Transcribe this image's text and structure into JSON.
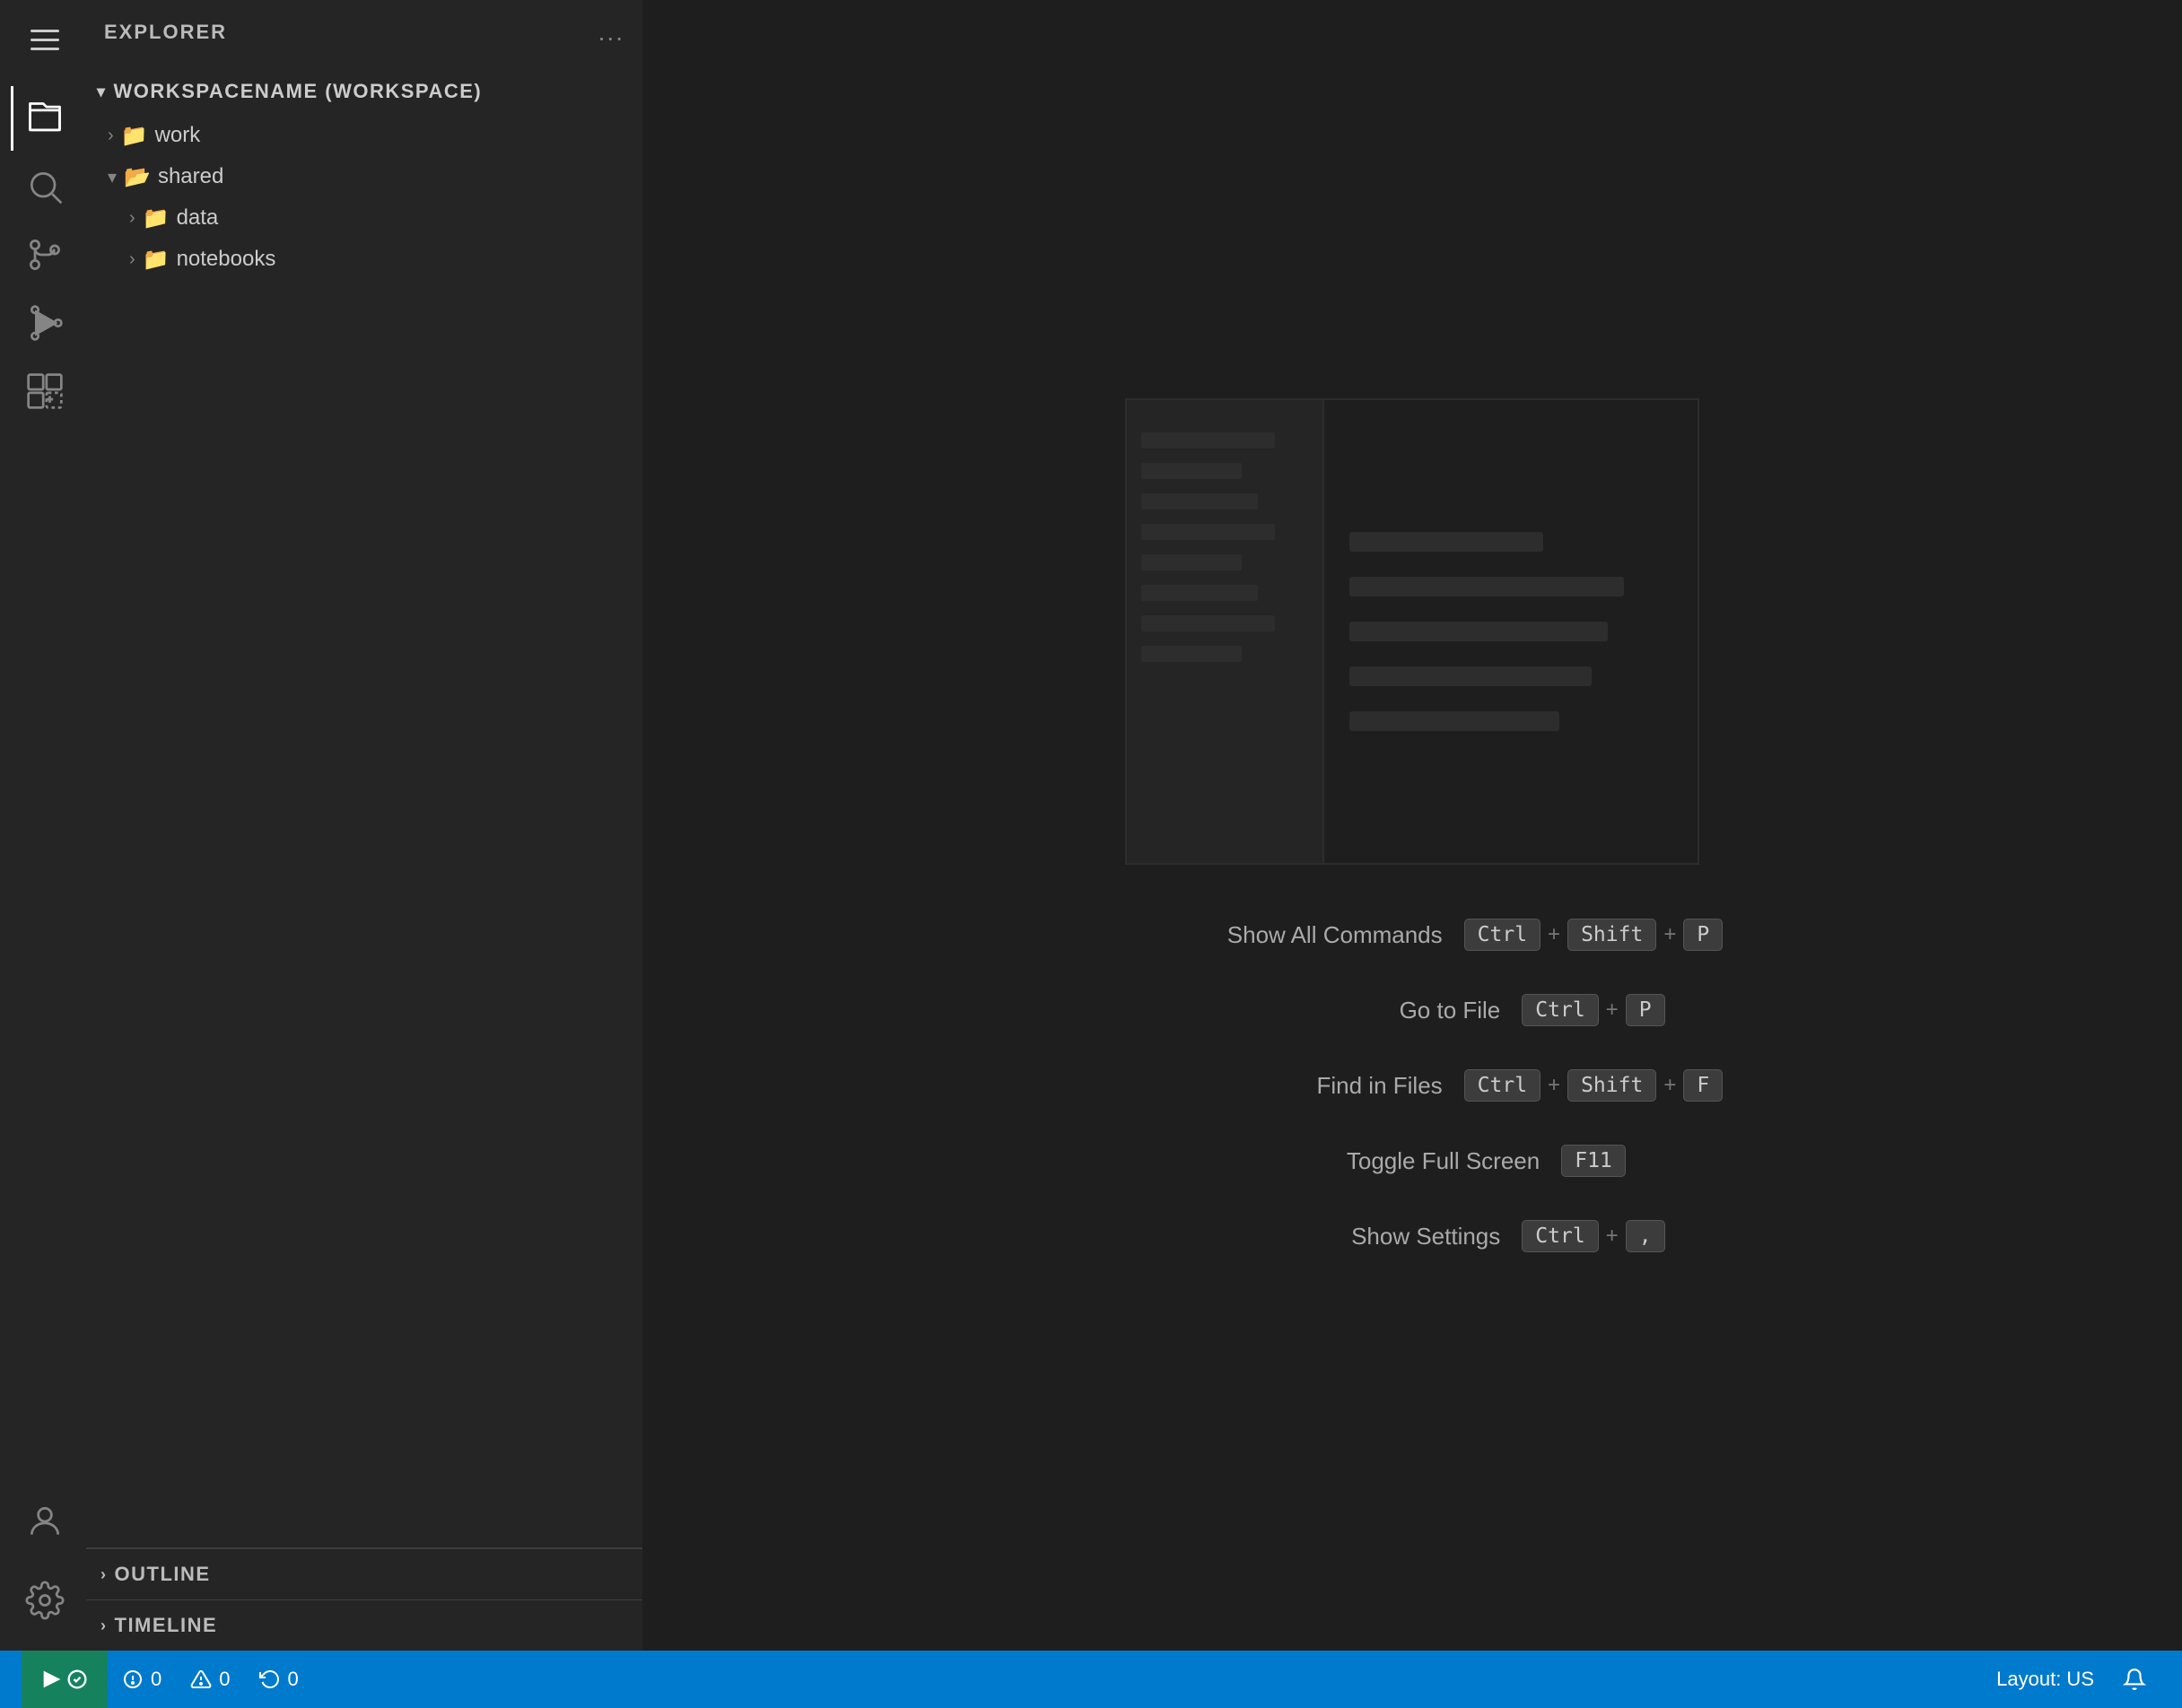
{
  "activityBar": {
    "icons": [
      {
        "name": "files-icon",
        "symbol": "files",
        "active": true
      },
      {
        "name": "search-icon",
        "symbol": "search"
      },
      {
        "name": "source-control-icon",
        "symbol": "source-control"
      },
      {
        "name": "run-debug-icon",
        "symbol": "run"
      },
      {
        "name": "extensions-icon",
        "symbol": "extensions"
      }
    ],
    "bottomIcons": [
      {
        "name": "account-icon",
        "symbol": "account"
      },
      {
        "name": "settings-icon",
        "symbol": "settings"
      }
    ]
  },
  "sidebar": {
    "header": "Explorer",
    "moreButton": "...",
    "tree": {
      "workspaceName": "WORKSPACENAME (WORKSPACE)",
      "items": [
        {
          "label": "work",
          "indent": 1,
          "collapsed": true,
          "type": "folder"
        },
        {
          "label": "shared",
          "indent": 1,
          "collapsed": false,
          "type": "folder"
        },
        {
          "label": "data",
          "indent": 2,
          "collapsed": true,
          "type": "folder"
        },
        {
          "label": "notebooks",
          "indent": 2,
          "collapsed": true,
          "type": "folder"
        }
      ]
    }
  },
  "bottomPanels": [
    {
      "label": "OUTLINE"
    },
    {
      "label": "TIMELINE"
    }
  ],
  "welcomeScreen": {
    "shortcuts": [
      {
        "label": "Show All Commands",
        "keys": [
          "Ctrl",
          "+",
          "Shift",
          "+",
          "P"
        ]
      },
      {
        "label": "Go to File",
        "keys": [
          "Ctrl",
          "+",
          "P"
        ]
      },
      {
        "label": "Find in Files",
        "keys": [
          "Ctrl",
          "+",
          "Shift",
          "+",
          "F"
        ]
      },
      {
        "label": "Toggle Full Screen",
        "keys": [
          "F11"
        ]
      },
      {
        "label": "Show Settings",
        "keys": [
          "Ctrl",
          "+",
          ","
        ]
      }
    ]
  },
  "statusBar": {
    "leftItems": [
      {
        "label": "⚙ 0",
        "icon": "error-icon"
      },
      {
        "label": "⚠ 0"
      },
      {
        "label": "↺ 0",
        "icon": "sync-icon"
      }
    ],
    "rightItems": [
      {
        "label": "Layout: US"
      },
      {
        "label": "🔔",
        "icon": "bell-icon"
      }
    ]
  }
}
